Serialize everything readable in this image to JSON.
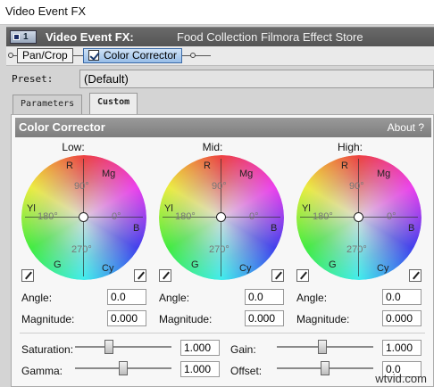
{
  "window": {
    "title": "Video Event FX"
  },
  "fx_header": {
    "number": "1",
    "title": "Video Event FX:",
    "plugin": "Food Collection Filmora Effect Store"
  },
  "chain": {
    "pan_crop": "Pan/Crop",
    "color_corrector": "Color Corrector"
  },
  "preset": {
    "label": "Preset:",
    "value": "(Default)"
  },
  "tabs": [
    {
      "label": "Parameters"
    },
    {
      "label": "Custom"
    }
  ],
  "panel": {
    "title": "Color Corrector",
    "about": "About  ?"
  },
  "wheels": [
    {
      "label": "Low:",
      "angle_label": "Angle:",
      "angle": "0.0",
      "magnitude_label": "Magnitude:",
      "magnitude": "0.000"
    },
    {
      "label": "Mid:",
      "angle_label": "Angle:",
      "angle": "0.0",
      "magnitude_label": "Magnitude:",
      "magnitude": "0.000"
    },
    {
      "label": "High:",
      "angle_label": "Angle:",
      "angle": "0.0",
      "magnitude_label": "Magnitude:",
      "magnitude": "0.000"
    }
  ],
  "wheel_marks": {
    "r": "R",
    "mg": "Mg",
    "b": "B",
    "cy": "Cy",
    "g": "G",
    "yl": "Yl",
    "deg90": "90°",
    "deg180": "180°",
    "deg0": "0°",
    "deg270": "270°"
  },
  "sliders": {
    "saturation": {
      "label": "Saturation:",
      "value": "1.000",
      "level": 0.35
    },
    "gamma": {
      "label": "Gamma:",
      "value": "1.000",
      "level": 0.5
    },
    "gain": {
      "label": "Gain:",
      "value": "1.000",
      "level": 0.47
    },
    "offset": {
      "label": "Offset:",
      "value": "0.0",
      "level": 0.5
    }
  },
  "watermark": "wtvid.com",
  "colors": {
    "header_bar": "#5f5f5f",
    "active_chain": "#97bde8",
    "panel_header": "#8a8a8a"
  }
}
